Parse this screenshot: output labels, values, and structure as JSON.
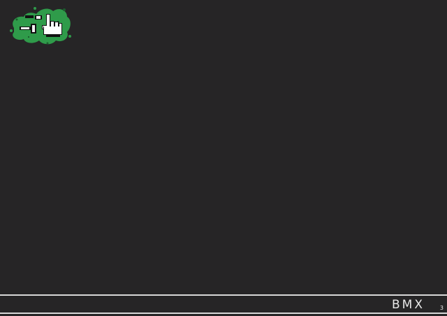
{
  "logo": {
    "icon": "green-splat-hand-cursor-icon",
    "splat_color": "#2f9b4a",
    "splat_dark": "#1c5d2e"
  },
  "footer": {
    "brand": "BMX",
    "page_number": "3",
    "line_color": "#d8d8d8"
  },
  "background_color": "#262526"
}
